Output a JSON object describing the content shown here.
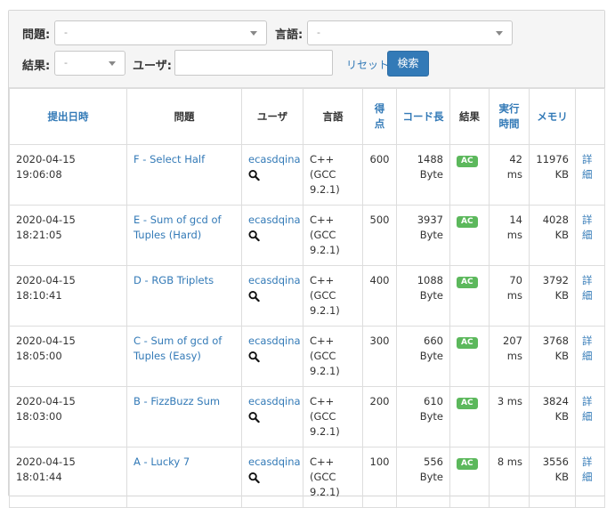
{
  "filters": {
    "problem_label": "問題:",
    "problem_value": "-",
    "language_label": "言語:",
    "language_value": "-",
    "result_label": "結果:",
    "result_value": "-",
    "user_label": "ユーザ:",
    "user_value": "",
    "reset_label": "リセット",
    "search_label": "検索"
  },
  "table": {
    "headers": {
      "date": "提出日時",
      "problem": "問題",
      "user": "ユーザ",
      "language": "言語",
      "score": "得点",
      "code_length": "コード長",
      "result": "結果",
      "exec_time": "実行時間",
      "memory": "メモリ"
    },
    "rows": [
      {
        "date": "2020-04-15 19:06:08",
        "problem": "F - Select Half",
        "user": "ecasdqina",
        "language": "C++ (GCC 9.2.1)",
        "score": "600",
        "code_length": "1488 Byte",
        "result": "AC",
        "time": "42 ms",
        "memory": "11976 KB",
        "detail": "詳細"
      },
      {
        "date": "2020-04-15 18:21:05",
        "problem": "E - Sum of gcd of Tuples (Hard)",
        "user": "ecasdqina",
        "language": "C++ (GCC 9.2.1)",
        "score": "500",
        "code_length": "3937 Byte",
        "result": "AC",
        "time": "14 ms",
        "memory": "4028 KB",
        "detail": "詳細"
      },
      {
        "date": "2020-04-15 18:10:41",
        "problem": "D - RGB Triplets",
        "user": "ecasdqina",
        "language": "C++ (GCC 9.2.1)",
        "score": "400",
        "code_length": "1088 Byte",
        "result": "AC",
        "time": "70 ms",
        "memory": "3792 KB",
        "detail": "詳細"
      },
      {
        "date": "2020-04-15 18:05:00",
        "problem": "C - Sum of gcd of Tuples (Easy)",
        "user": "ecasdqina",
        "language": "C++ (GCC 9.2.1)",
        "score": "300",
        "code_length": "660 Byte",
        "result": "AC",
        "time": "207 ms",
        "memory": "3768 KB",
        "detail": "詳細"
      },
      {
        "date": "2020-04-15 18:03:00",
        "problem": "B - FizzBuzz Sum",
        "user": "ecasdqina",
        "language": "C++ (GCC 9.2.1)",
        "score": "200",
        "code_length": "610 Byte",
        "result": "AC",
        "time": "3 ms",
        "memory": "3824 KB",
        "detail": "詳細"
      },
      {
        "date": "2020-04-15 18:01:44",
        "problem": "A - Lucky 7",
        "user": "ecasdqina",
        "language": "C++ (GCC 9.2.1)",
        "score": "100",
        "code_length": "556 Byte",
        "result": "AC",
        "time": "8 ms",
        "memory": "3556 KB",
        "detail": "詳細"
      }
    ]
  },
  "colors": {
    "link": "#337ab7",
    "accepted": "#5cb85c",
    "filter_bg": "#f5f5f5"
  },
  "icons": {
    "user_search": "magnifier-icon",
    "select_caret": "chevron-down-icon"
  }
}
